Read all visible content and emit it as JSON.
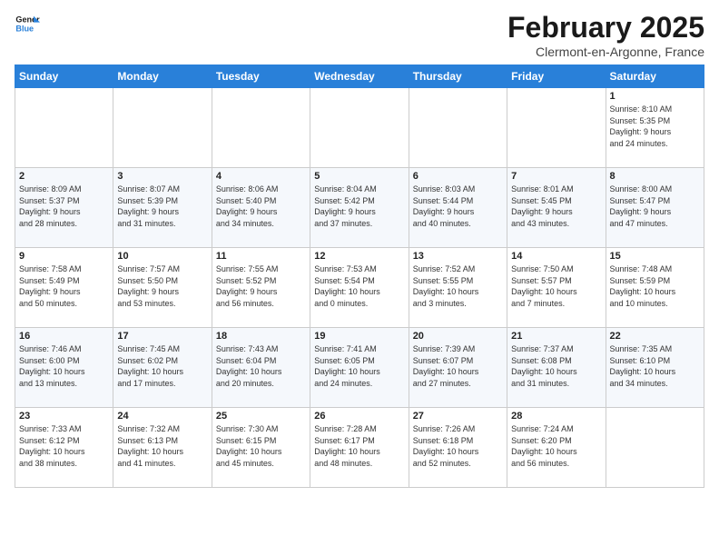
{
  "logo": {
    "line1": "General",
    "line2": "Blue"
  },
  "title": "February 2025",
  "subtitle": "Clermont-en-Argonne, France",
  "days_of_week": [
    "Sunday",
    "Monday",
    "Tuesday",
    "Wednesday",
    "Thursday",
    "Friday",
    "Saturday"
  ],
  "weeks": [
    [
      {
        "day": "",
        "info": ""
      },
      {
        "day": "",
        "info": ""
      },
      {
        "day": "",
        "info": ""
      },
      {
        "day": "",
        "info": ""
      },
      {
        "day": "",
        "info": ""
      },
      {
        "day": "",
        "info": ""
      },
      {
        "day": "1",
        "info": "Sunrise: 8:10 AM\nSunset: 5:35 PM\nDaylight: 9 hours\nand 24 minutes."
      }
    ],
    [
      {
        "day": "2",
        "info": "Sunrise: 8:09 AM\nSunset: 5:37 PM\nDaylight: 9 hours\nand 28 minutes."
      },
      {
        "day": "3",
        "info": "Sunrise: 8:07 AM\nSunset: 5:39 PM\nDaylight: 9 hours\nand 31 minutes."
      },
      {
        "day": "4",
        "info": "Sunrise: 8:06 AM\nSunset: 5:40 PM\nDaylight: 9 hours\nand 34 minutes."
      },
      {
        "day": "5",
        "info": "Sunrise: 8:04 AM\nSunset: 5:42 PM\nDaylight: 9 hours\nand 37 minutes."
      },
      {
        "day": "6",
        "info": "Sunrise: 8:03 AM\nSunset: 5:44 PM\nDaylight: 9 hours\nand 40 minutes."
      },
      {
        "day": "7",
        "info": "Sunrise: 8:01 AM\nSunset: 5:45 PM\nDaylight: 9 hours\nand 43 minutes."
      },
      {
        "day": "8",
        "info": "Sunrise: 8:00 AM\nSunset: 5:47 PM\nDaylight: 9 hours\nand 47 minutes."
      }
    ],
    [
      {
        "day": "9",
        "info": "Sunrise: 7:58 AM\nSunset: 5:49 PM\nDaylight: 9 hours\nand 50 minutes."
      },
      {
        "day": "10",
        "info": "Sunrise: 7:57 AM\nSunset: 5:50 PM\nDaylight: 9 hours\nand 53 minutes."
      },
      {
        "day": "11",
        "info": "Sunrise: 7:55 AM\nSunset: 5:52 PM\nDaylight: 9 hours\nand 56 minutes."
      },
      {
        "day": "12",
        "info": "Sunrise: 7:53 AM\nSunset: 5:54 PM\nDaylight: 10 hours\nand 0 minutes."
      },
      {
        "day": "13",
        "info": "Sunrise: 7:52 AM\nSunset: 5:55 PM\nDaylight: 10 hours\nand 3 minutes."
      },
      {
        "day": "14",
        "info": "Sunrise: 7:50 AM\nSunset: 5:57 PM\nDaylight: 10 hours\nand 7 minutes."
      },
      {
        "day": "15",
        "info": "Sunrise: 7:48 AM\nSunset: 5:59 PM\nDaylight: 10 hours\nand 10 minutes."
      }
    ],
    [
      {
        "day": "16",
        "info": "Sunrise: 7:46 AM\nSunset: 6:00 PM\nDaylight: 10 hours\nand 13 minutes."
      },
      {
        "day": "17",
        "info": "Sunrise: 7:45 AM\nSunset: 6:02 PM\nDaylight: 10 hours\nand 17 minutes."
      },
      {
        "day": "18",
        "info": "Sunrise: 7:43 AM\nSunset: 6:04 PM\nDaylight: 10 hours\nand 20 minutes."
      },
      {
        "day": "19",
        "info": "Sunrise: 7:41 AM\nSunset: 6:05 PM\nDaylight: 10 hours\nand 24 minutes."
      },
      {
        "day": "20",
        "info": "Sunrise: 7:39 AM\nSunset: 6:07 PM\nDaylight: 10 hours\nand 27 minutes."
      },
      {
        "day": "21",
        "info": "Sunrise: 7:37 AM\nSunset: 6:08 PM\nDaylight: 10 hours\nand 31 minutes."
      },
      {
        "day": "22",
        "info": "Sunrise: 7:35 AM\nSunset: 6:10 PM\nDaylight: 10 hours\nand 34 minutes."
      }
    ],
    [
      {
        "day": "23",
        "info": "Sunrise: 7:33 AM\nSunset: 6:12 PM\nDaylight: 10 hours\nand 38 minutes."
      },
      {
        "day": "24",
        "info": "Sunrise: 7:32 AM\nSunset: 6:13 PM\nDaylight: 10 hours\nand 41 minutes."
      },
      {
        "day": "25",
        "info": "Sunrise: 7:30 AM\nSunset: 6:15 PM\nDaylight: 10 hours\nand 45 minutes."
      },
      {
        "day": "26",
        "info": "Sunrise: 7:28 AM\nSunset: 6:17 PM\nDaylight: 10 hours\nand 48 minutes."
      },
      {
        "day": "27",
        "info": "Sunrise: 7:26 AM\nSunset: 6:18 PM\nDaylight: 10 hours\nand 52 minutes."
      },
      {
        "day": "28",
        "info": "Sunrise: 7:24 AM\nSunset: 6:20 PM\nDaylight: 10 hours\nand 56 minutes."
      },
      {
        "day": "",
        "info": ""
      }
    ]
  ]
}
